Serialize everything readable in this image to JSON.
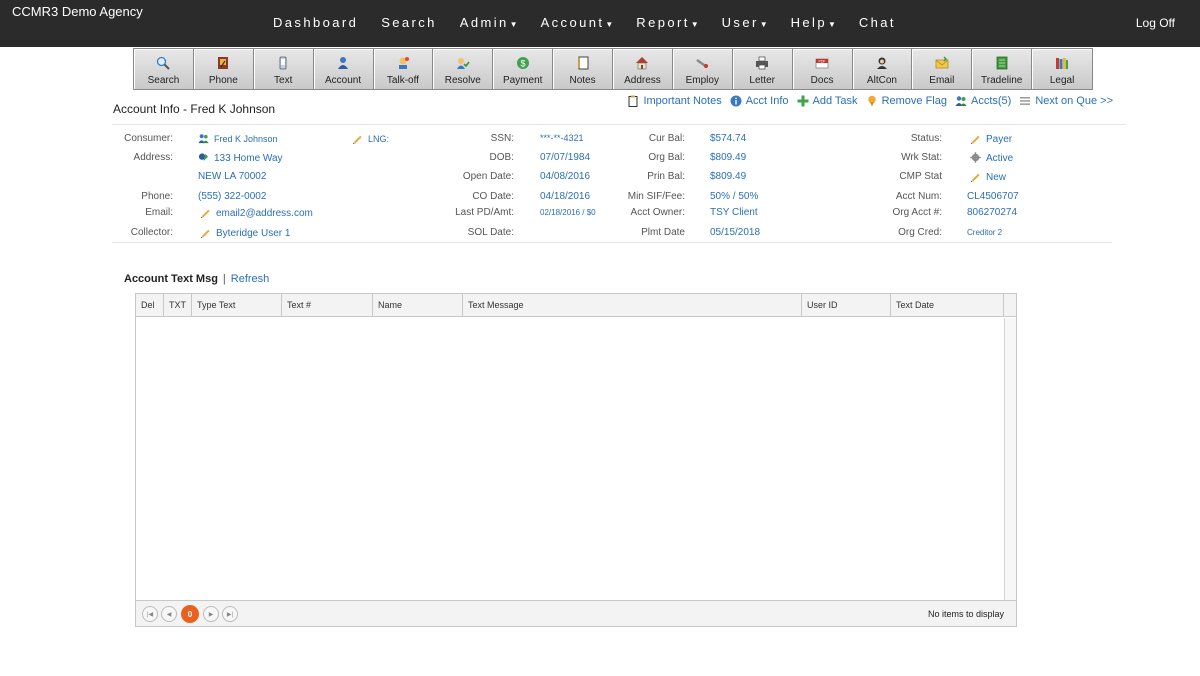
{
  "app": {
    "brand": "CCMR3 Demo Agency",
    "logoff": "Log Off"
  },
  "nav": [
    {
      "label": "Dashboard",
      "dropdown": false
    },
    {
      "label": "Search",
      "dropdown": false
    },
    {
      "label": "Admin",
      "dropdown": true
    },
    {
      "label": "Account",
      "dropdown": true
    },
    {
      "label": "Report",
      "dropdown": true
    },
    {
      "label": "User",
      "dropdown": true
    },
    {
      "label": "Help",
      "dropdown": true
    },
    {
      "label": "Chat",
      "dropdown": false
    }
  ],
  "toolbar": [
    {
      "label": "Search",
      "icon": "magnifier-icon"
    },
    {
      "label": "Phone",
      "icon": "phone-book-icon"
    },
    {
      "label": "Text",
      "icon": "mobile-phone-icon"
    },
    {
      "label": "Account",
      "icon": "user-icon"
    },
    {
      "label": "Talk-off",
      "icon": "talk-off-icon"
    },
    {
      "label": "Resolve",
      "icon": "resolve-icon"
    },
    {
      "label": "Payment",
      "icon": "dollar-coin-icon"
    },
    {
      "label": "Notes",
      "icon": "notes-icon"
    },
    {
      "label": "Address",
      "icon": "house-icon"
    },
    {
      "label": "Employ",
      "icon": "briefcase-icon"
    },
    {
      "label": "Letter",
      "icon": "printer-icon"
    },
    {
      "label": "Docs",
      "icon": "pdf-docs-icon"
    },
    {
      "label": "AltCon",
      "icon": "alt-contact-icon"
    },
    {
      "label": "Email",
      "icon": "envelope-icon"
    },
    {
      "label": "Tradeline",
      "icon": "ledger-icon"
    },
    {
      "label": "Legal",
      "icon": "books-icon"
    }
  ],
  "account_title": "Account Info - Fred K Johnson",
  "quicklinks": {
    "important_notes": "Important Notes",
    "acct_info": "Acct Info",
    "add_task": "Add Task",
    "remove_flag": "Remove Flag",
    "accts": "Accts(5)",
    "next_on_que": "Next on Que >>"
  },
  "info": {
    "consumer_label": "Consumer:",
    "consumer": "Fred K Johnson",
    "lng_label": "LNG:",
    "address_label": "Address:",
    "address1": "133 Home Way",
    "address2": "NEW LA 70002",
    "phone_label": "Phone:",
    "phone": "(555) 322-0002",
    "email_label": "Email:",
    "email": "email2@address.com",
    "collector_label": "Collector:",
    "collector": "Byteridge User 1",
    "ssn_label": "SSN:",
    "ssn": "***-**-4321",
    "dob_label": "DOB:",
    "dob": "07/07/1984",
    "open_date_label": "Open Date:",
    "open_date": "04/08/2016",
    "co_date_label": "CO Date:",
    "co_date": "04/18/2016",
    "last_pd_label": "Last PD/Amt:",
    "last_pd": "02/18/2016 / $0",
    "sol_date_label": "SOL Date:",
    "sol_date": "",
    "cur_bal_label": "Cur Bal:",
    "cur_bal": "$574.74",
    "org_bal_label": "Org Bal:",
    "org_bal": "$809.49",
    "prin_bal_label": "Prin Bal:",
    "prin_bal": "$809.49",
    "min_sif_label": "Min SIF/Fee:",
    "min_sif": "50% / 50%",
    "acct_owner_label": "Acct Owner:",
    "acct_owner": "TSY Client",
    "plmt_date_label": "Plmt Date",
    "plmt_date": "05/15/2018",
    "status_label": "Status:",
    "status": "Payer",
    "wrk_stat_label": "Wrk Stat:",
    "wrk_stat": "Active",
    "cmp_stat_label": "CMP Stat",
    "cmp_stat": "New",
    "acct_num_label": "Acct Num:",
    "acct_num": "CL4506707",
    "org_acct_label": "Org Acct #:",
    "org_acct": "806270274",
    "org_cred_label": "Org Cred:",
    "org_cred": "Creditor 2"
  },
  "text_section": {
    "title": "Account Text Msg",
    "separator": "|",
    "refresh": "Refresh",
    "columns": [
      "Del",
      "TXT",
      "Type Text",
      "Text #",
      "Name",
      "Text Message",
      "User ID",
      "Text Date"
    ],
    "current_page": "0",
    "no_items": "No items to display"
  }
}
